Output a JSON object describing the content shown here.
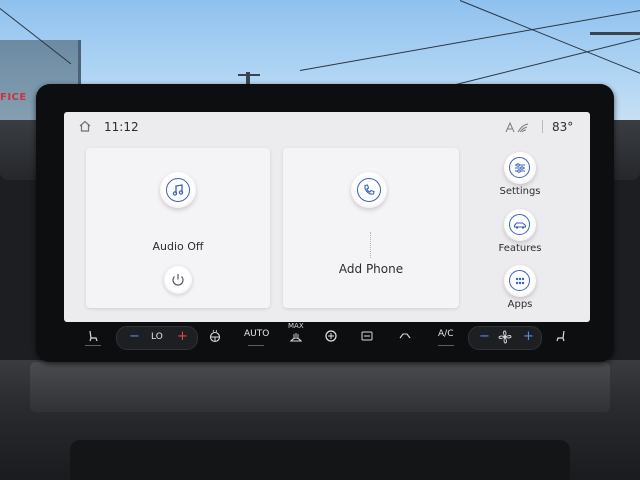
{
  "status_bar": {
    "time": "11:12",
    "outside_temp": "83°",
    "icons": [
      "home-icon",
      "connectivity-icon"
    ]
  },
  "tiles": {
    "audio": {
      "label": "Audio Off",
      "icon": "music-note-icon",
      "secondary_icon": "power-icon"
    },
    "phone": {
      "label": "Add Phone",
      "icon": "phone-icon"
    }
  },
  "side_menu": [
    {
      "label": "Settings",
      "icon": "sliders-icon"
    },
    {
      "label": "Features",
      "icon": "car-icon"
    },
    {
      "label": "Apps",
      "icon": "apps-grid-icon"
    }
  ],
  "climate_bar": {
    "driver_temp": "LO",
    "auto_label": "AUTO",
    "max_label": "MAX",
    "ac_label": "A/C",
    "icons": [
      "seat-heat-left-icon",
      "steering-heat-icon",
      "defrost-front-icon",
      "fan-icon",
      "recirc-icon",
      "defrost-rear-icon",
      "seat-heat-right-icon"
    ]
  },
  "colors": {
    "accent_blue": "#3a62b8",
    "temp_up_red": "#e04848",
    "temp_down_blue": "#5a8fe6",
    "screen_bg": "#ececee"
  },
  "sign_text": "FICE"
}
